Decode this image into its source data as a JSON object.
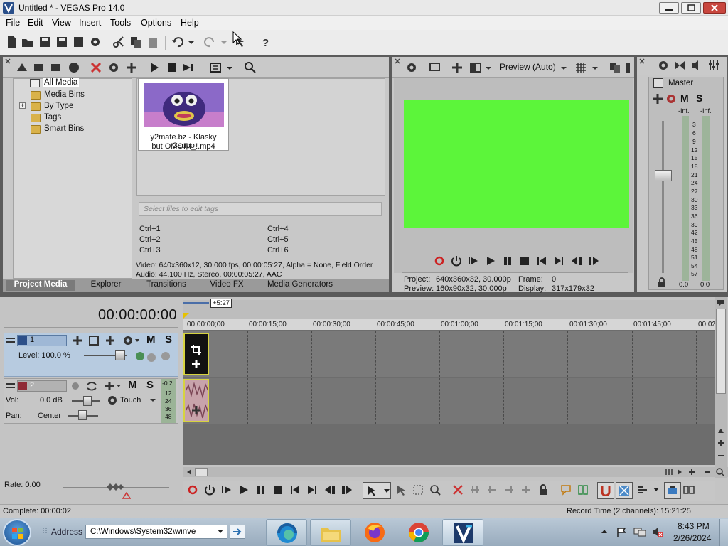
{
  "window": {
    "title": "Untitled * - VEGAS Pro 14.0"
  },
  "menu": [
    "File",
    "Edit",
    "View",
    "Insert",
    "Tools",
    "Options",
    "Help"
  ],
  "project_media": {
    "tree": [
      "All Media",
      "Media Bins",
      "By Type",
      "Tags",
      "Smart Bins"
    ],
    "expand_glyph": "+",
    "media_item": {
      "name_line1": "y2mate.bz - Klasky Csupo",
      "name_line2": "but OMORI_!.mp4"
    },
    "tag_placeholder": "Select files to edit tags",
    "shortcuts": [
      "Ctrl+1",
      "Ctrl+2",
      "Ctrl+3",
      "Ctrl+4",
      "Ctrl+5",
      "Ctrl+6"
    ],
    "info_video": "Video: 640x360x12, 30.000 fps, 00:00:05:27, Alpha = None, Field Order",
    "info_audio": "Audio: 44,100 Hz, Stereo, 00:00:05:27, AAC"
  },
  "tabs": [
    "Project Media",
    "Explorer",
    "Transitions",
    "Video FX",
    "Media Generators"
  ],
  "preview": {
    "mode": "Preview (Auto)",
    "project_label": "Project:",
    "project_value": "640x360x32, 30.000p",
    "preview_label": "Preview:",
    "preview_value": "160x90x32, 30.000p",
    "frame_label": "Frame:",
    "frame_value": "0",
    "display_label": "Display:",
    "display_value": "317x179x32",
    "screen_color": "#5cf53a"
  },
  "mixer": {
    "title": "Master",
    "m": "M",
    "s": "S",
    "inf_left": "-Inf.",
    "inf_right": "-Inf.",
    "scale": [
      "3",
      "6",
      "9",
      "12",
      "15",
      "18",
      "21",
      "24",
      "27",
      "30",
      "33",
      "36",
      "39",
      "42",
      "45",
      "48",
      "51",
      "54",
      "57"
    ],
    "value_left": "0.0",
    "value_right": "0.0"
  },
  "timeline": {
    "timecode": "00:00:00:00",
    "marker_length": "+5:27",
    "ruler": [
      "00:00:00;00",
      "00:00:15;00",
      "00:00:30;00",
      "00:00:45;00",
      "00:01:00;00",
      "00:01:15;00",
      "00:01:30;00",
      "00:01:45;00",
      "00:02"
    ],
    "track1": {
      "number": "1",
      "level_label": "Level: 100.0 %",
      "m": "M",
      "s": "S"
    },
    "track2": {
      "number": "2",
      "vol_label": "Vol:",
      "vol_value": "0.0 dB",
      "pan_label": "Pan:",
      "pan_value": "Center",
      "touch": "Touch",
      "m": "M",
      "s": "S",
      "meter_top": "-0.2",
      "meter_scale": [
        "12",
        "24",
        "36",
        "48"
      ]
    },
    "rate": "Rate: 0.00"
  },
  "status": {
    "complete": "Complete: 00:00:02",
    "record_time": "Record Time (2 channels): 15:21:25"
  },
  "taskbar": {
    "address_label": "Address",
    "address_value": "C:\\Windows\\System32\\winve",
    "time": "8:43 PM",
    "date": "2/26/2024"
  }
}
